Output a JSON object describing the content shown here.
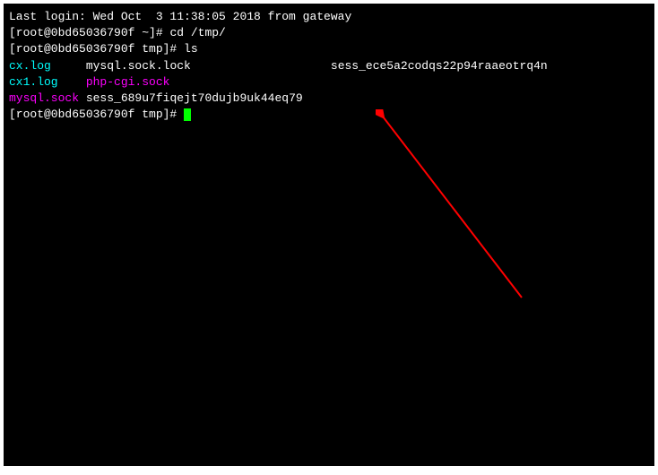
{
  "terminal": {
    "last_login": "Last login: Wed Oct  3 11:38:05 2018 from gateway",
    "prompt1": "[root@0bd65036790f ~]# ",
    "cmd1": "cd /tmp/",
    "prompt2": "[root@0bd65036790f tmp]# ",
    "cmd2": "ls",
    "ls_row1": {
      "col1": "cx.log",
      "col2": "mysql.sock.lock",
      "col3": "sess_ece5a2codqs22p94raaeotrq4n"
    },
    "ls_row2": {
      "col1": "cx1.log",
      "col2": "php-cgi.sock"
    },
    "ls_row3": {
      "col1": "mysql.sock",
      "col2": "sess_689u7fiqejt70dujb9uk44eq79"
    },
    "prompt3": "[root@0bd65036790f tmp]# "
  }
}
